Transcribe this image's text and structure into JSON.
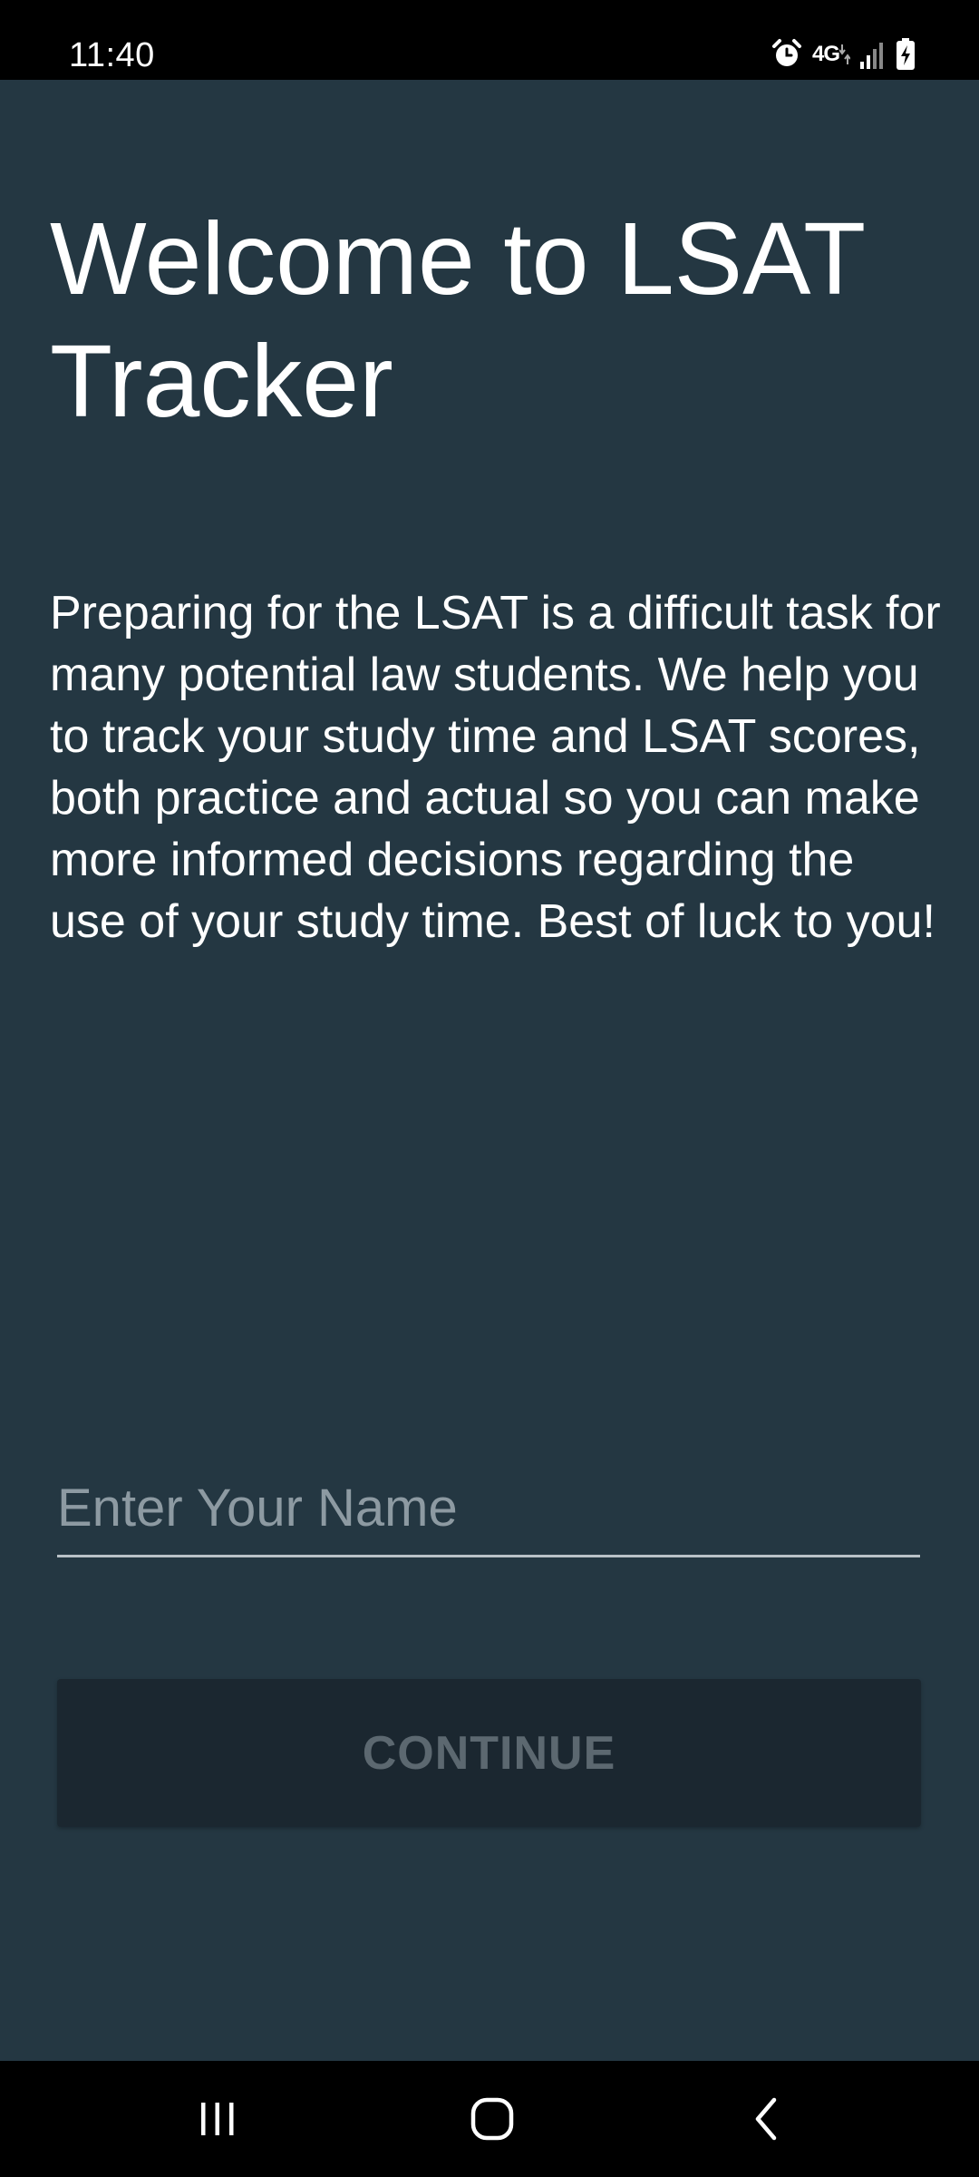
{
  "status_bar": {
    "time": "11:40",
    "network_label": "4G",
    "icons": [
      "alarm-icon",
      "network-4g-icon",
      "signal-icon",
      "battery-charging-icon"
    ]
  },
  "main": {
    "title": "Welcome to LSAT Tracker",
    "description": "Preparing for the LSAT is a difficult task for many potential law students. We help you to track your study time and LSAT scores, both practice and actual so you can make more informed decisions regarding the use of your study time. Best of luck to you!",
    "name_input": {
      "value": "",
      "placeholder": "Enter Your Name"
    },
    "continue_button": {
      "label": "CONTINUE",
      "enabled": false
    }
  },
  "nav_bar": {
    "buttons": [
      "recent-apps-icon",
      "home-icon",
      "back-icon"
    ]
  },
  "colors": {
    "background": "#243742",
    "button_disabled_bg": "#1b2730",
    "button_disabled_text": "#5c6870",
    "placeholder": "#8d9aa2",
    "text": "#ffffff"
  }
}
